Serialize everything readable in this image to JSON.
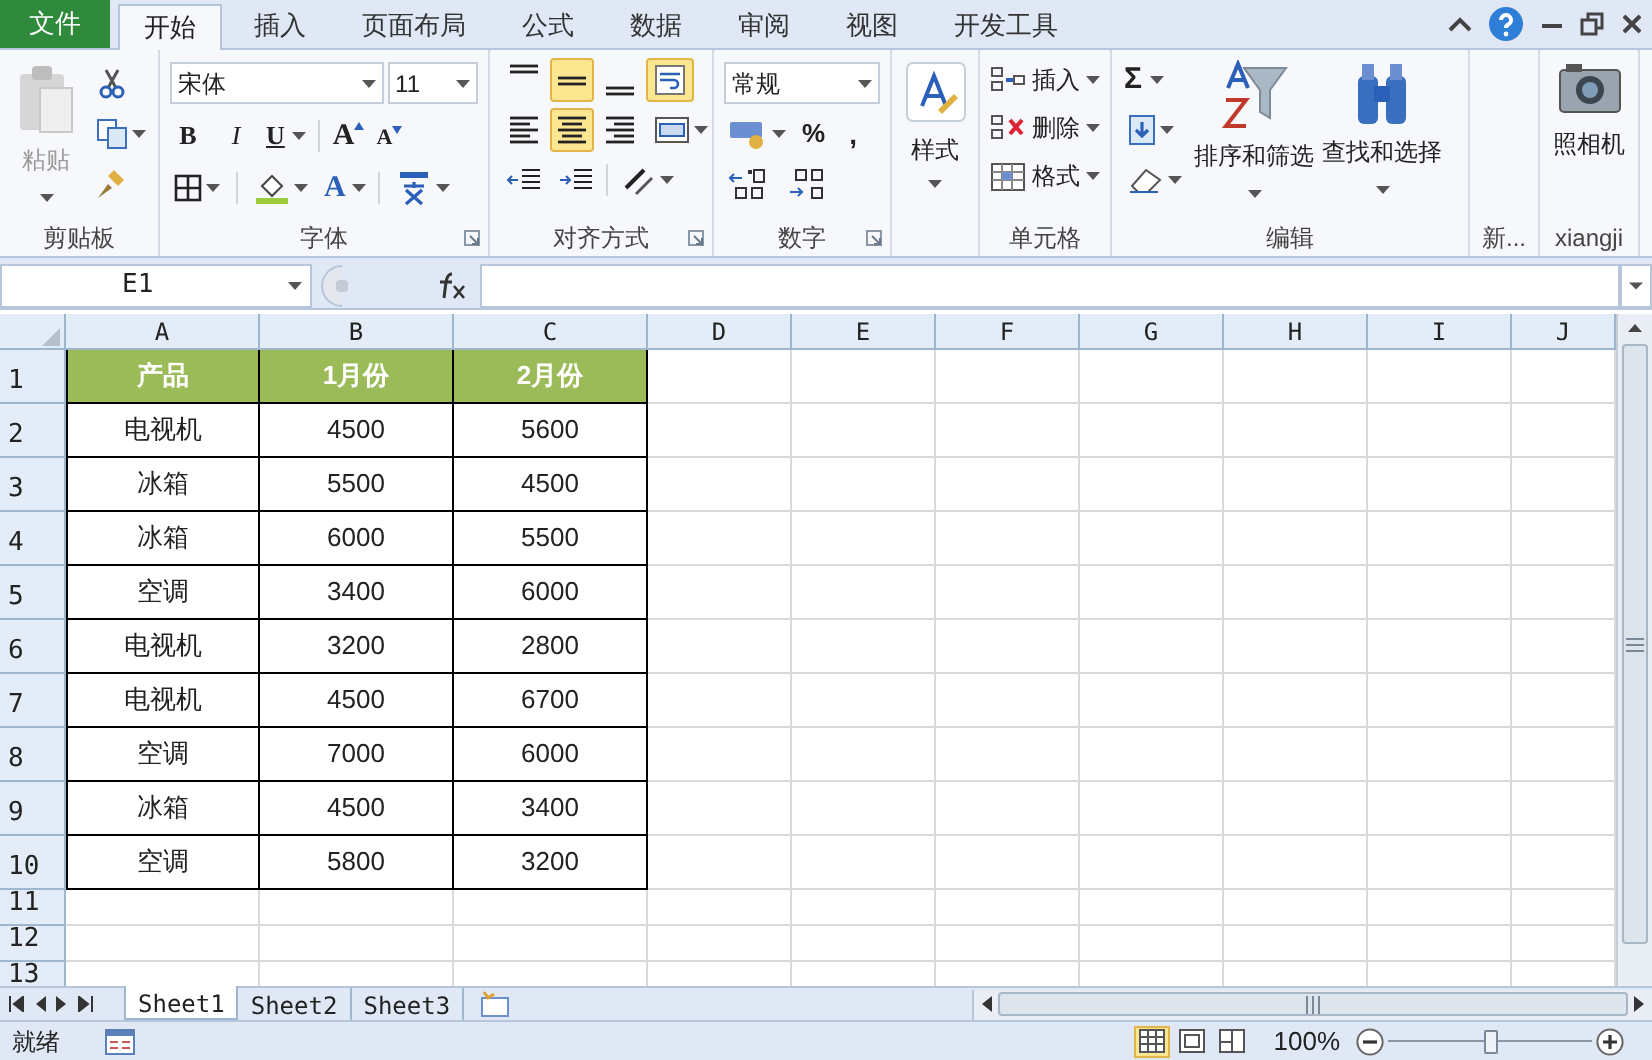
{
  "ribbon_tabs": [
    {
      "label": "文件",
      "kind": "file",
      "selected": false
    },
    {
      "label": "开始",
      "kind": "tab",
      "selected": true
    },
    {
      "label": "插入",
      "kind": "tab",
      "selected": false
    },
    {
      "label": "页面布局",
      "kind": "tab",
      "selected": false
    },
    {
      "label": "公式",
      "kind": "tab",
      "selected": false
    },
    {
      "label": "数据",
      "kind": "tab",
      "selected": false
    },
    {
      "label": "审阅",
      "kind": "tab",
      "selected": false
    },
    {
      "label": "视图",
      "kind": "tab",
      "selected": false
    },
    {
      "label": "开发工具",
      "kind": "tab",
      "selected": false
    }
  ],
  "ribbon": {
    "clipboard": {
      "label": "剪贴板",
      "paste": "粘贴"
    },
    "font": {
      "label": "字体",
      "font_name": "宋体",
      "font_size": "11",
      "bold": "B",
      "italic": "I",
      "underline": "U",
      "grow_font": "A",
      "shrink_font": "A",
      "font_color": "A"
    },
    "alignment": {
      "label": "对齐方式",
      "buttons": [
        {
          "kind": "top",
          "selected": false
        },
        {
          "kind": "middle",
          "selected": true
        },
        {
          "kind": "bottom",
          "selected": false
        },
        {
          "kind": "wrap",
          "selected": true
        },
        {
          "kind": "left",
          "selected": false
        },
        {
          "kind": "center",
          "selected": true
        },
        {
          "kind": "right",
          "selected": false
        },
        {
          "kind": "merge",
          "selected": false
        }
      ]
    },
    "number": {
      "label": "数字",
      "format": "常规",
      "percent": "%",
      "comma": ","
    },
    "styles": {
      "button": "样式"
    },
    "cells": {
      "label": "单元格",
      "buttons": [
        {
          "kind": "insert",
          "label": "插入"
        },
        {
          "kind": "delete",
          "label": "删除"
        },
        {
          "kind": "format",
          "label": "格式"
        }
      ]
    },
    "editing": {
      "label": "编辑",
      "autosum": "Σ",
      "buttons": [
        {
          "kind": "sort",
          "label": "排序和筛选"
        },
        {
          "kind": "find",
          "label": "查找和选择"
        }
      ]
    },
    "new_group": {
      "label": "新..."
    },
    "camera_group": {
      "label": "xiangji",
      "button": "照相机"
    }
  },
  "formula_bar": {
    "name_box": "E1"
  },
  "sheet": {
    "columns": [
      "A",
      "B",
      "C",
      "D",
      "E",
      "F",
      "G",
      "H",
      "I",
      "J"
    ],
    "row_numbers": [
      "1",
      "2",
      "3",
      "4",
      "5",
      "6",
      "7",
      "8",
      "9",
      "10",
      "11",
      "12",
      "13"
    ],
    "header": [
      "产品",
      "1月份",
      "2月份"
    ],
    "rows": [
      [
        "电视机",
        "4500",
        "5600"
      ],
      [
        "冰箱",
        "5500",
        "4500"
      ],
      [
        "冰箱",
        "6000",
        "5500"
      ],
      [
        "空调",
        "3400",
        "6000"
      ],
      [
        "电视机",
        "3200",
        "2800"
      ],
      [
        "电视机",
        "4500",
        "6700"
      ],
      [
        "空调",
        "7000",
        "6000"
      ],
      [
        "冰箱",
        "4500",
        "3400"
      ],
      [
        "空调",
        "5800",
        "3200"
      ]
    ]
  },
  "sheet_tabs": [
    {
      "label": "Sheet1",
      "selected": true
    },
    {
      "label": "Sheet2",
      "selected": false
    },
    {
      "label": "Sheet3",
      "selected": false
    }
  ],
  "status_bar": {
    "status": "就绪",
    "views": [
      {
        "kind": "normal",
        "selected": true
      },
      {
        "kind": "page_layout",
        "selected": false
      },
      {
        "kind": "page_break",
        "selected": false
      }
    ],
    "zoom": "100%",
    "zoom_slider": {
      "level": 0.5
    }
  }
}
